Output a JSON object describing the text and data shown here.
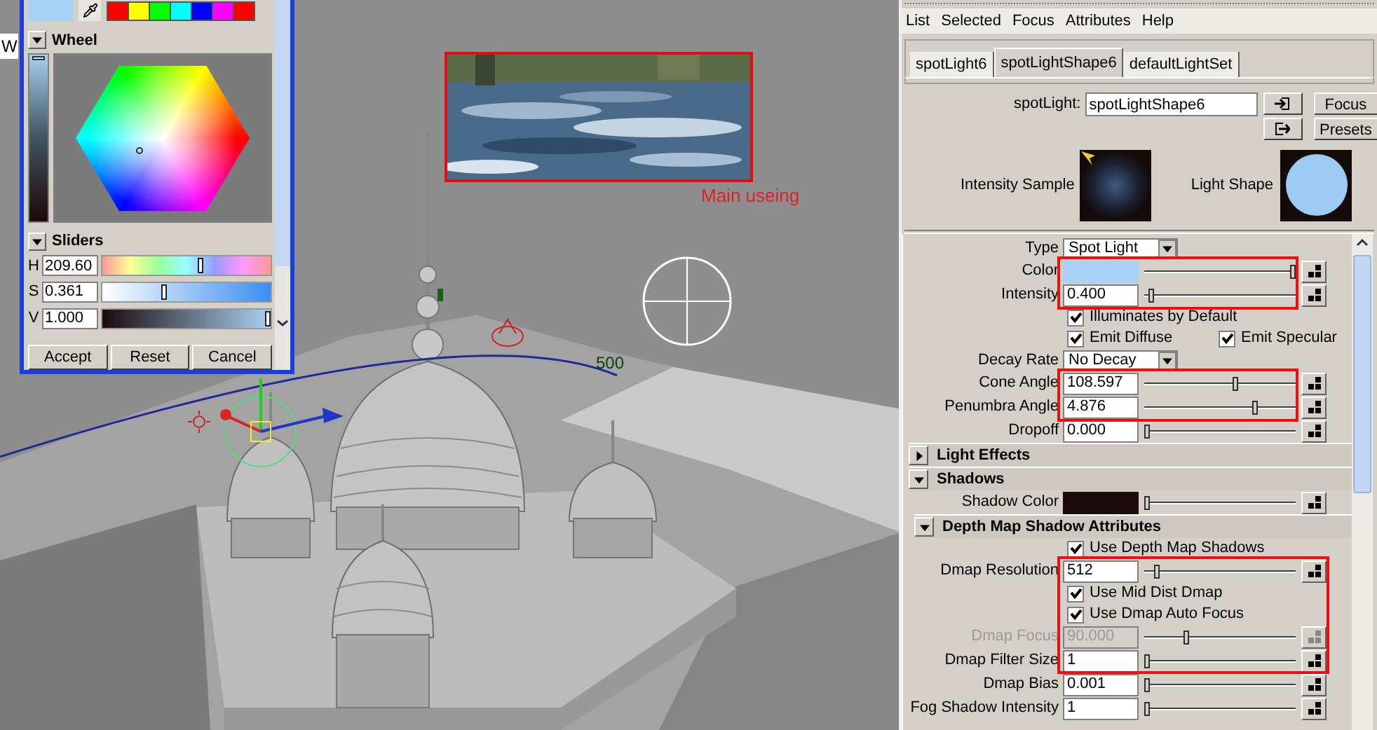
{
  "viewport": {
    "corner_label": "W",
    "caption": "Main useing",
    "distance_label": "500"
  },
  "color_chooser": {
    "palette": [
      {
        "color": "#ff0000"
      },
      {
        "color": "#ffff00"
      },
      {
        "color": "#00ff00"
      },
      {
        "color": "#00ffff"
      },
      {
        "color": "#0000ff"
      },
      {
        "color": "#ff00ff"
      },
      {
        "color": "#ff0000"
      }
    ],
    "wheel": {
      "title": "Wheel",
      "expanded": true
    },
    "sliders": {
      "title": "Sliders",
      "expanded": true,
      "channels": [
        {
          "label": "H",
          "value": "209.60",
          "level": 0.58
        },
        {
          "label": "S",
          "value": "0.361",
          "level": 0.37
        },
        {
          "label": "V",
          "value": "1.000",
          "level": 0.98
        }
      ]
    },
    "buttons": [
      "Accept",
      "Reset",
      "Cancel"
    ]
  },
  "attribute_editor": {
    "menu": [
      "List",
      "Selected",
      "Focus",
      "Attributes",
      "Help"
    ],
    "tabs": [
      {
        "label": "spotLight6",
        "selected": false
      },
      {
        "label": "spotLightShape6",
        "selected": true
      },
      {
        "label": "defaultLightSet",
        "selected": false
      }
    ],
    "node_label": "spotLight:",
    "node_name": "spotLightShape6",
    "buttons": [
      "Focus",
      "Presets"
    ],
    "samples": [
      {
        "label": "Intensity Sample"
      },
      {
        "label": "Light Shape"
      }
    ],
    "attributes": [
      {
        "kind": "dropdown",
        "label": "Type",
        "value": "Spot Light"
      },
      {
        "kind": "color",
        "label": "Color",
        "color": "#a9d3f6",
        "level": 0.98
      },
      {
        "kind": "number",
        "label": "Intensity",
        "value": "0.400",
        "level": 0.05,
        "disabled": false
      },
      {
        "kind": "checkbox",
        "label": "Illuminates by Default",
        "checked": true
      },
      {
        "kind": "checkbox_pair",
        "items": [
          {
            "label": "Emit Diffuse",
            "checked": true
          },
          {
            "label": "Emit Specular",
            "checked": true
          }
        ]
      },
      {
        "kind": "dropdown",
        "label": "Decay Rate",
        "value": "No Decay"
      },
      {
        "kind": "number",
        "label": "Cone Angle",
        "value": "108.597",
        "level": 0.6,
        "disabled": false
      },
      {
        "kind": "number",
        "label": "Penumbra Angle",
        "value": "4.876",
        "level": 0.73,
        "disabled": false
      },
      {
        "kind": "number",
        "label": "Dropoff",
        "value": "0.000",
        "level": 0.02,
        "disabled": false
      },
      {
        "kind": "section",
        "label": "Light Effects",
        "expanded": false
      },
      {
        "kind": "section",
        "label": "Shadows",
        "expanded": true
      },
      {
        "kind": "color",
        "label": "Shadow Color",
        "color": "#1a0a0a",
        "level": 0.02
      },
      {
        "kind": "subsection",
        "label": "Depth Map Shadow Attributes",
        "expanded": true
      },
      {
        "kind": "checkbox",
        "label": "Use Depth Map Shadows",
        "checked": true
      },
      {
        "kind": "number",
        "label": "Dmap Resolution",
        "value": "512",
        "level": 0.08,
        "disabled": false
      },
      {
        "kind": "checkbox",
        "label": "Use Mid Dist Dmap",
        "checked": true
      },
      {
        "kind": "checkbox",
        "label": "Use Dmap Auto Focus",
        "checked": true
      },
      {
        "kind": "number",
        "label": "Dmap Focus",
        "value": "90.000",
        "level": 0.28,
        "disabled": true
      },
      {
        "kind": "number",
        "label": "Dmap Filter Size",
        "value": "1",
        "level": 0.02,
        "disabled": false
      },
      {
        "kind": "number",
        "label": "Dmap Bias",
        "value": "0.001",
        "level": 0.02,
        "disabled": false
      },
      {
        "kind": "number",
        "label": "Fog Shadow Intensity",
        "value": "1",
        "level": 0.02,
        "disabled": false
      }
    ]
  }
}
